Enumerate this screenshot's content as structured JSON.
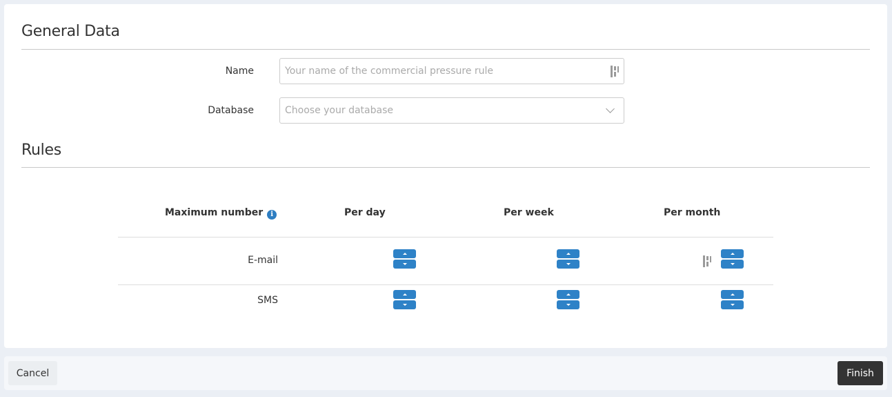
{
  "general": {
    "title": "General Data",
    "name_label": "Name",
    "name_placeholder": "Your name of the commercial pressure rule",
    "name_value": "",
    "database_label": "Database",
    "database_placeholder": "Choose your database"
  },
  "rules": {
    "title": "Rules",
    "columns": {
      "max": "Maximum number",
      "day": "Per day",
      "week": "Per week",
      "month": "Per month"
    },
    "rows": [
      {
        "label": "E-mail",
        "per_day": "",
        "per_week": "",
        "per_month": ""
      },
      {
        "label": "SMS",
        "per_day": "",
        "per_week": "",
        "per_month": ""
      }
    ]
  },
  "footer": {
    "cancel_label": "Cancel",
    "finish_label": "Finish"
  },
  "colors": {
    "accent": "#2e82c7",
    "primary_button": "#333333",
    "background": "#ebeff5"
  }
}
